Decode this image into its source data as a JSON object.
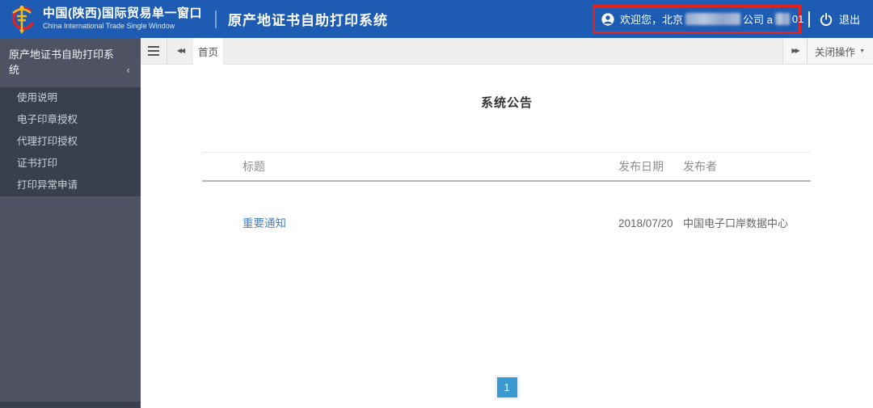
{
  "header": {
    "brand_title": "中国(陕西)国际贸易单一窗口",
    "brand_subtitle": "China International Trade Single Window",
    "title_divider": "|",
    "app_title": "原产地证书自助打印系统",
    "welcome_prefix": "欢迎您，北京",
    "welcome_mid": "公司 a",
    "welcome_suffix": "01",
    "logout_label": "退出"
  },
  "sidebar": {
    "title": "原产地证书自助打印系统",
    "collapse_glyph": "‹",
    "items": [
      {
        "label": "使用说明"
      },
      {
        "label": "电子印章授权"
      },
      {
        "label": "代理打印授权"
      },
      {
        "label": "证书打印"
      },
      {
        "label": "打印异常申请"
      }
    ]
  },
  "tabbar": {
    "active_tab": "首页",
    "close_menu_label": "关闭操作",
    "caret_glyph": "▼"
  },
  "main": {
    "title": "系统公告",
    "table": {
      "col_title": "标题",
      "col_date": "发布日期",
      "col_publisher": "发布者",
      "rows": [
        {
          "title": "重要通知",
          "date": "2018/07/20",
          "publisher": "中国电子口岸数据中心"
        }
      ]
    },
    "pagination_current": "1"
  },
  "colors": {
    "header_bg": "#1e5cb3",
    "annotation_red": "#e8201a",
    "sidebar_bg": "#4e5263",
    "sidebar_menu_bg": "#3a3f4e",
    "link_blue": "#4a7ec0",
    "pagination_bg": "#3a99d3"
  }
}
